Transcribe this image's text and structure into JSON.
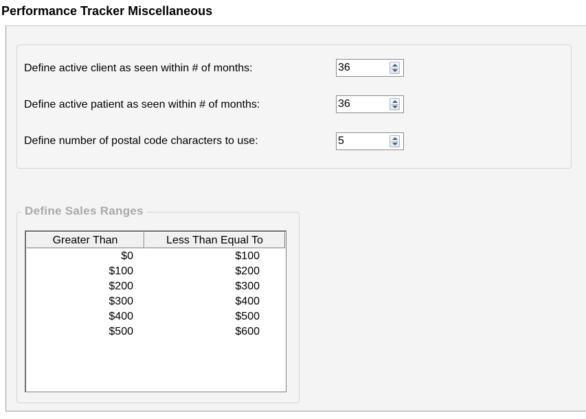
{
  "header": {
    "title": "Performance Tracker Miscellaneous"
  },
  "settings": [
    {
      "label": "Define active client as seen within # of months:",
      "value": "36"
    },
    {
      "label": "Define active patient as seen within # of months:",
      "value": "36"
    },
    {
      "label": "Define number of postal code characters to use:",
      "value": "5"
    }
  ],
  "sales_ranges": {
    "legend": "Define Sales Ranges",
    "columns": [
      "Greater Than",
      "Less Than Equal To"
    ],
    "rows": [
      [
        "$0",
        "$100"
      ],
      [
        "$100",
        "$200"
      ],
      [
        "$200",
        "$300"
      ],
      [
        "$300",
        "$400"
      ],
      [
        "$400",
        "$500"
      ],
      [
        "$500",
        "$600"
      ]
    ]
  }
}
